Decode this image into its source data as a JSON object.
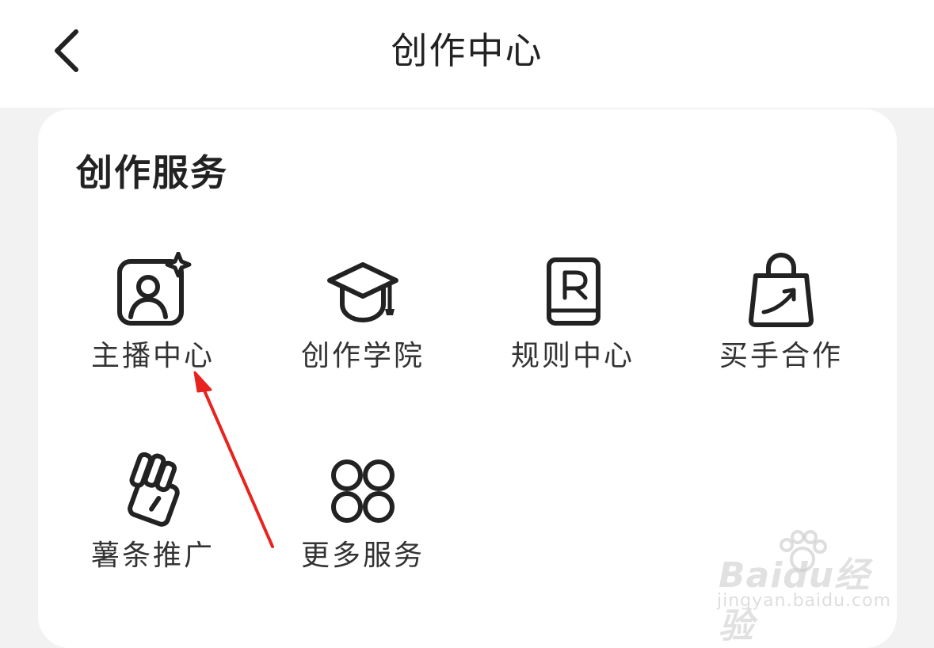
{
  "header": {
    "title": "创作中心",
    "back_icon": "chevron-left-icon"
  },
  "services": {
    "title": "创作服务",
    "items": [
      {
        "label": "主播中心",
        "icon": "anchor-profile-icon"
      },
      {
        "label": "创作学院",
        "icon": "graduation-cap-icon"
      },
      {
        "label": "规则中心",
        "icon": "rule-book-icon"
      },
      {
        "label": "买手合作",
        "icon": "shopping-bag-icon"
      },
      {
        "label": "薯条推广",
        "icon": "fries-promo-icon"
      },
      {
        "label": "更多服务",
        "icon": "more-grid-icon"
      }
    ]
  },
  "annotation": {
    "arrow_color": "#e8231f",
    "points_to": "主播中心"
  },
  "watermark": {
    "brand": "Baidu经验",
    "url": "jingyan.baidu.com"
  }
}
